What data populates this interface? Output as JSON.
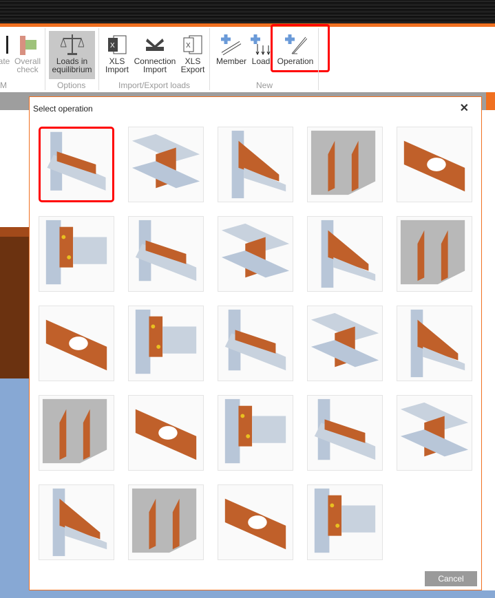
{
  "ribbon": {
    "buttons": [
      {
        "label": "ate",
        "line2": ""
      },
      {
        "label": "Overall",
        "line2": "check"
      },
      {
        "label": "Loads in",
        "line2": "equilibrium"
      },
      {
        "label": "XLS",
        "line2": "Import"
      },
      {
        "label": "Connection",
        "line2": "Import"
      },
      {
        "label": "XLS",
        "line2": "Export"
      },
      {
        "label": "Member",
        "line2": ""
      },
      {
        "label": "Load",
        "line2": ""
      },
      {
        "label": "Operation",
        "line2": ""
      }
    ],
    "groups": [
      "M",
      "Options",
      "Import/Export loads",
      "New"
    ]
  },
  "dialog": {
    "title": "Select operation",
    "close": "✕",
    "cancel": "Cancel",
    "tiles": [
      "cut-member",
      "plate-cut",
      "stiffening-plate",
      "rib-stiffeners",
      "plate-with-opening",
      "end-plate",
      "fin-plate",
      "end-plate-column",
      "end-plate-beam",
      "cap-plate",
      "haunch",
      "cleat-angle",
      "splice",
      "web-splice",
      "base-plate",
      "stub-cleat",
      "cover-plate",
      "gusset-plate",
      "bolted-flange",
      "flange-splice",
      "anchoring-grid",
      "tube-connection",
      "timber-node",
      "timber-beam-connection"
    ],
    "selected_index": 0
  },
  "colors": {
    "accent": "#f07020",
    "highlight": "#ff0000",
    "steel": "#b8c6d8",
    "plate": "#c0602a"
  }
}
